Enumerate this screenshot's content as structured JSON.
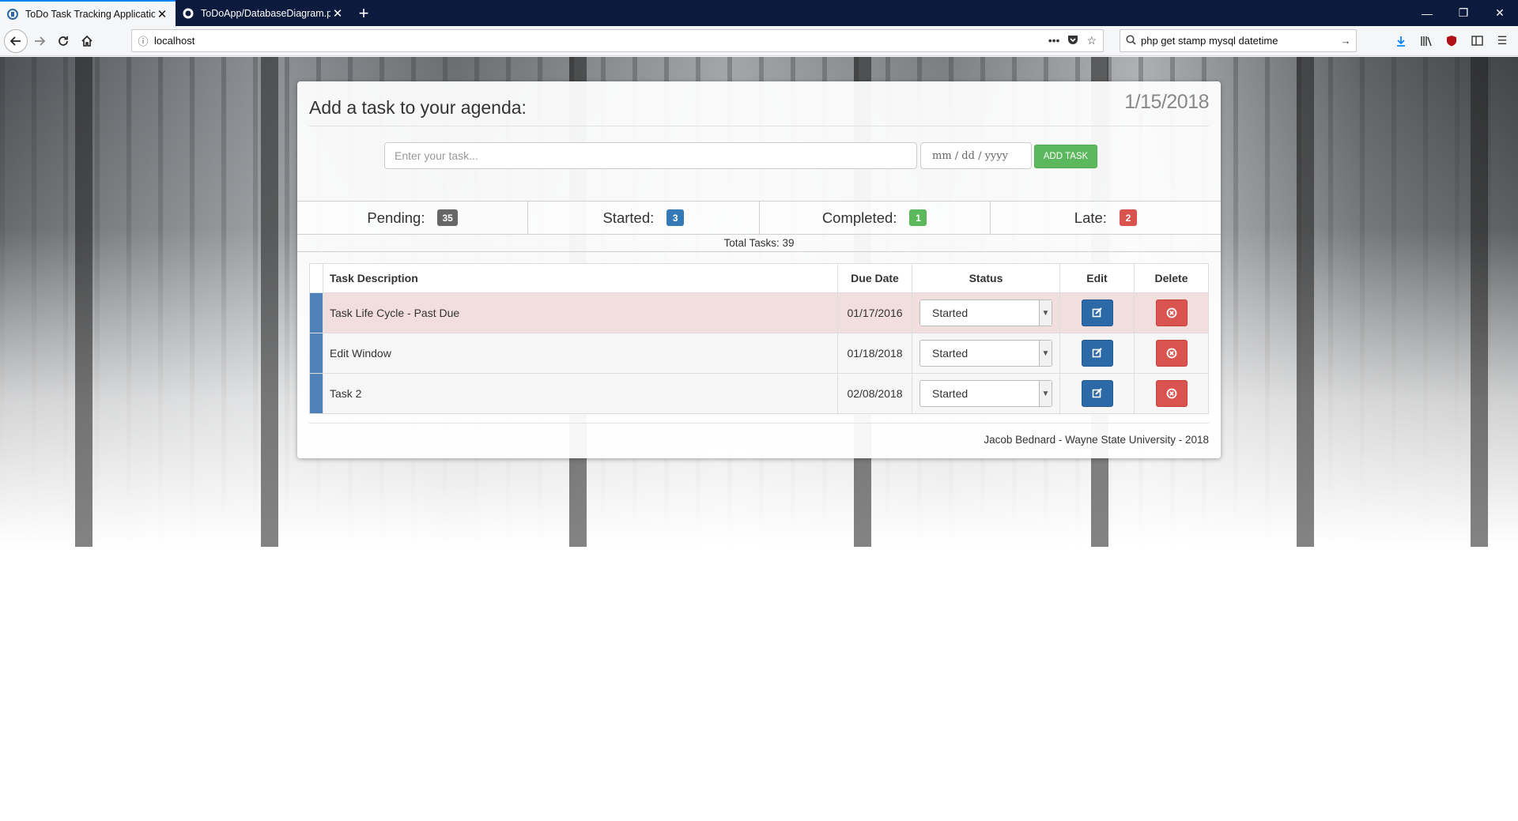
{
  "browser": {
    "tabs": [
      {
        "title": "ToDo Task Tracking Application",
        "active": true
      },
      {
        "title": "ToDoApp/DatabaseDiagram.pn",
        "active": false
      }
    ],
    "url": "localhost",
    "search_value": "php get stamp mysql datetime"
  },
  "card": {
    "title": "Add a task to your agenda:",
    "date": "1/15/2018",
    "task_placeholder": "Enter your task...",
    "date_placeholder": "mm / dd / yyyy",
    "add_button": "ADD TASK"
  },
  "stats": {
    "pending_label": "Pending:",
    "pending_count": "35",
    "started_label": "Started:",
    "started_count": "3",
    "completed_label": "Completed:",
    "completed_count": "1",
    "late_label": "Late:",
    "late_count": "2",
    "total": "Total Tasks: 39",
    "colors": {
      "pending": "#666666",
      "started": "#337ab7",
      "completed": "#5cb85c",
      "late": "#d9534f"
    }
  },
  "table": {
    "headers": {
      "description": "Task Description",
      "due": "Due Date",
      "status": "Status",
      "edit": "Edit",
      "delete": "Delete"
    },
    "rows": [
      {
        "description": "Task Life Cycle - Past Due",
        "due": "01/17/2016",
        "status": "Started",
        "late": true
      },
      {
        "description": "Edit Window",
        "due": "01/18/2018",
        "status": "Started",
        "late": false
      },
      {
        "description": "Task 2",
        "due": "02/08/2018",
        "status": "Started",
        "late": false
      }
    ]
  },
  "footer": "Jacob Bednard - Wayne State University - 2018"
}
